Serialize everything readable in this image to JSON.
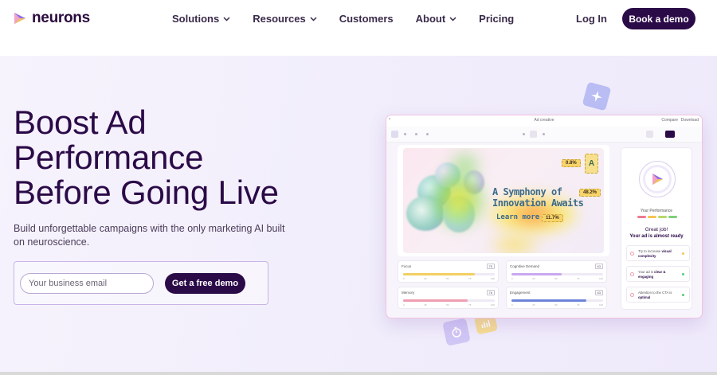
{
  "nav": {
    "logo_text": "neurons",
    "menu": [
      {
        "label": "Solutions",
        "has_dropdown": true
      },
      {
        "label": "Resources",
        "has_dropdown": true
      },
      {
        "label": "Customers",
        "has_dropdown": false
      },
      {
        "label": "About",
        "has_dropdown": true
      },
      {
        "label": "Pricing",
        "has_dropdown": false
      }
    ],
    "login_label": "Log In",
    "cta_label": "Book a demo"
  },
  "hero": {
    "headline_lines": [
      "Boost Ad",
      "Performance",
      "Before Going Live"
    ],
    "subheadline": "Build unforgettable campaigns with the only marketing AI built on neuroscience.",
    "email_placeholder": "Your business email",
    "submit_label": "Get a free demo"
  },
  "mockup": {
    "window_title": "Ad creative",
    "compare_label": "Compare",
    "download_label": "Download",
    "ad": {
      "title_lines": [
        "A Symphony of",
        "Innovation Awaits"
      ],
      "more_label": "Learn more",
      "badges": [
        "0.8%",
        "48.2%",
        "11.7%"
      ],
      "logo_letter": "A"
    },
    "metrics": [
      {
        "label": "Focus",
        "value": "75",
        "fill": 0.78,
        "color": "#f3cf63"
      },
      {
        "label": "Cognitive Demand",
        "value": "63",
        "fill": 0.55,
        "color": "#c9a7ee"
      },
      {
        "label": "Memory",
        "value": "76",
        "fill": 0.7,
        "color": "#ef9eb2"
      },
      {
        "label": "Engagement",
        "value": "83",
        "fill": 0.82,
        "color": "#6c84d8"
      }
    ],
    "tick_labels": [
      "0",
      "25",
      "50",
      "75",
      "100"
    ],
    "performance": {
      "label": "Your Performance",
      "bar_colors": [
        "#ef7a8f",
        "#f6c454",
        "#b7d86a",
        "#7ed07a"
      ],
      "headline": "Great job!",
      "status": "Your ad is almost ready",
      "tips": [
        {
          "prefix": "Try to increase",
          "emphasis": "visual complexity",
          "dot": "#f6c454"
        },
        {
          "prefix": "Your ad is",
          "emphasis": "clear & engaging",
          "dot": "#5cc77a"
        },
        {
          "prefix": "Attention to the CTA is",
          "emphasis": "optimal",
          "dot": "#5cc77a"
        }
      ]
    }
  },
  "colors": {
    "brand_dark": "#2b0a48",
    "hero_bg": "#f3effc"
  }
}
